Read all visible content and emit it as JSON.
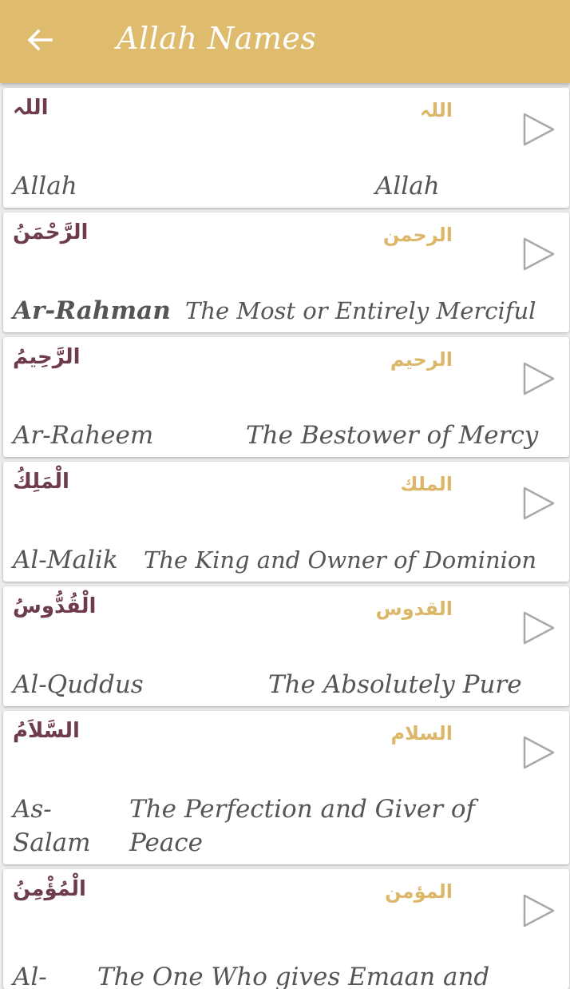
{
  "appbar": {
    "title": "Allah Names",
    "back_icon": "arrow-left-icon"
  },
  "names": [
    {
      "arabic_vowelled": "اللہ",
      "arabic_plain": "اللہ",
      "transliteration": "Allah",
      "meaning": "Allah"
    },
    {
      "arabic_vowelled": "الرَّحْمَنُ",
      "arabic_plain": "الرحمن",
      "transliteration": "Ar-Rahman",
      "meaning": "The Most or Entirely Merciful"
    },
    {
      "arabic_vowelled": "الرَّحِيمُ",
      "arabic_plain": "الرحيم",
      "transliteration": "Ar-Raheem",
      "meaning": "The Bestower of Mercy"
    },
    {
      "arabic_vowelled": "الْمَلِكُ",
      "arabic_plain": "الملك",
      "transliteration": "Al-Malik",
      "meaning": "The King and Owner of Dominion"
    },
    {
      "arabic_vowelled": "الْقُدُّوسُ",
      "arabic_plain": "القدوس",
      "transliteration": "Al-Quddus",
      "meaning": "The Absolutely Pure"
    },
    {
      "arabic_vowelled": "السَّلاَمُ",
      "arabic_plain": "السلام",
      "transliteration": "As-Salam",
      "meaning": "The Perfection and Giver of Peace"
    },
    {
      "arabic_vowelled": "الْمُؤْمِنُ",
      "arabic_plain": "المؤمن",
      "transliteration": "Al-",
      "meaning": "The One Who gives Emaan and"
    }
  ],
  "play_icon": "play-icon",
  "colors": {
    "appbar": "#dfbb6e",
    "arabic_vowelled": "#6e3a4e",
    "arabic_plain": "#dcb76a",
    "text": "#555555"
  }
}
